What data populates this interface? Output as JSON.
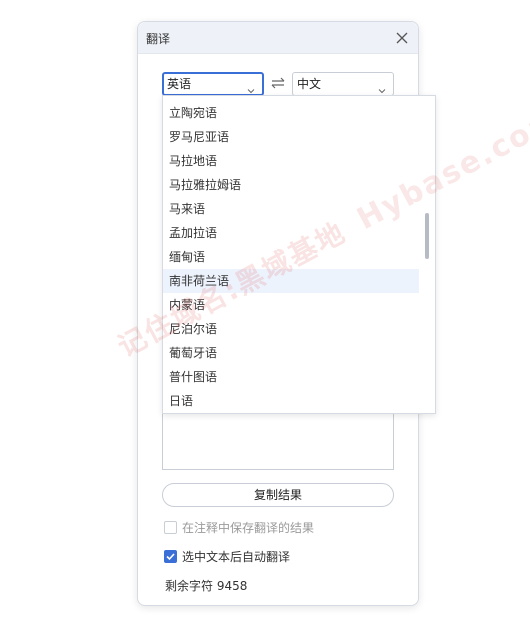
{
  "window": {
    "title": "翻译"
  },
  "source_lang": {
    "selected": "英语"
  },
  "target_lang": {
    "selected": "中文"
  },
  "dropdown": {
    "options": [
      "立陶宛语",
      "罗马尼亚语",
      "马拉地语",
      "马拉雅拉姆语",
      "马来语",
      "孟加拉语",
      "缅甸语",
      "南非荷兰语",
      "内蒙语",
      "尼泊尔语",
      "葡萄牙语",
      "普什图语",
      "日语"
    ],
    "highlighted": "南非荷兰语"
  },
  "actions": {
    "copy_label": "复制结果"
  },
  "options": {
    "save_in_comment": {
      "label": "在注释中保存翻译的结果",
      "checked": false
    },
    "auto_translate": {
      "label": "选中文本后自动翻译",
      "checked": true
    }
  },
  "status": {
    "remaining": "剩余字符 9458"
  },
  "watermark": {
    "line1": "记住域名:黑域基地",
    "line2": "Hybase.com"
  },
  "colors": {
    "accent": "#3b6fd8",
    "titlebar": "#eef2f8",
    "highlight": "#edf3fd"
  },
  "icons": {
    "close": "close-icon",
    "swap": "swap-arrows-icon",
    "chevron": "chevron-down-icon",
    "check": "checkmark-icon"
  }
}
